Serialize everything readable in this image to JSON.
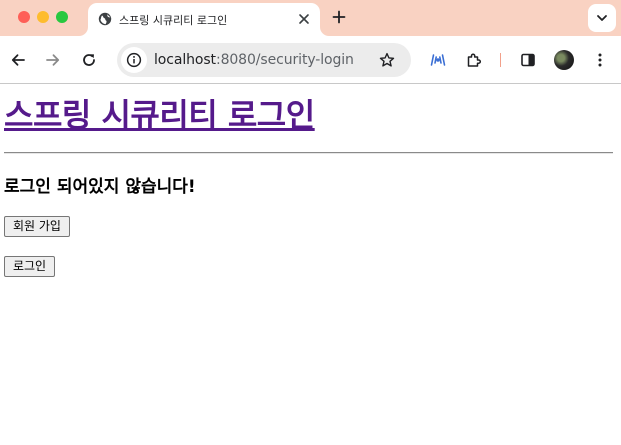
{
  "browser": {
    "tab": {
      "title": "스프링 시큐리티 로그인"
    },
    "omnibox": {
      "url_host": "localhost",
      "url_rest": ":8080/security-login"
    },
    "icons": {
      "tab_favicon": "globe-icon",
      "tab_close": "close-icon",
      "new_tab": "plus-icon",
      "back": "arrow-left-icon",
      "forward": "arrow-right-icon",
      "reload": "reload-icon",
      "site_info": "info-icon",
      "bookmark": "star-icon",
      "extension_1": "broadcast-icon",
      "extensions": "puzzle-icon",
      "side_panel": "side-panel-icon",
      "menu": "kebab-menu-icon"
    },
    "colors": {
      "tab_strip": "#f9d2c2",
      "active_tab": "#ffffff"
    }
  },
  "page": {
    "title": "스프링 시큐리티 로그인",
    "status_message": "로그인 되어있지 않습니다!",
    "buttons": {
      "signup": "회원 가입",
      "login": "로그인"
    },
    "colors": {
      "title_link": "#551a8b"
    }
  }
}
